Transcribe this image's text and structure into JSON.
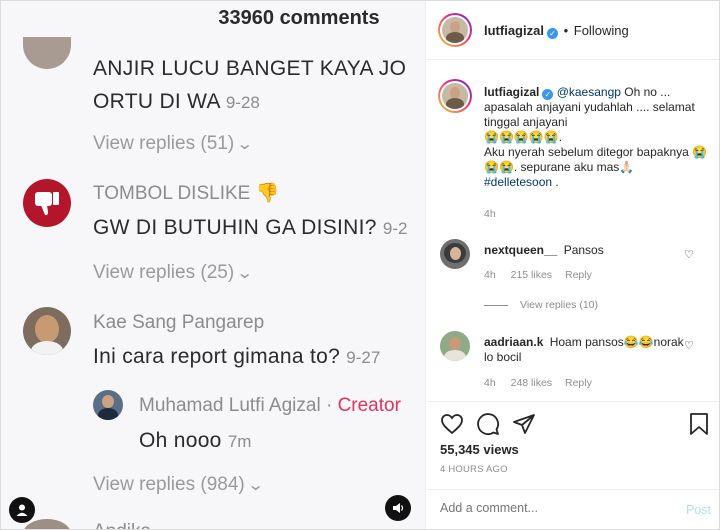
{
  "video": {
    "heading": "33960 comments",
    "comments": [
      {
        "text": "ANJIR LUCU BANGET KAYA JO",
        "text2": "ORTU DI WA",
        "date": "9-28",
        "replies": "View replies (51)"
      },
      {
        "name": "TOMBOL DISLIKE 👎",
        "text": "GW DI BUTUHIN GA DISINI?",
        "date": "9-2",
        "replies": "View replies (25)"
      },
      {
        "name": "Kae Sang Pangarep",
        "text": "Ini cara report gimana to?",
        "date": "9-27"
      },
      {
        "name": "Muhamad Lutfi Agizal",
        "sep": "·",
        "creator": "Creator",
        "text": "Oh nooo",
        "date": "7m",
        "replies": "View replies (984)"
      }
    ],
    "cut_name": "Andika"
  },
  "post": {
    "username": "lutfiagizal",
    "dot": "•",
    "following": "Following",
    "caption": {
      "username": "lutfiagizal",
      "mention": "@kaesangp",
      "line1": " Oh no ... apasalah anjayani yudahlah .... selamat tinggal anjayani",
      "line2": "😭😭😭😭😭.",
      "line3": "Aku nyerah sebelum ditegor bapaknya 😭😭😭. sepurane aku mas🙏🏻",
      "hashtag": "#delletesoon",
      "tail": " .",
      "time": "4h"
    },
    "comments": [
      {
        "user": "nextqueen__",
        "text": "Pansos",
        "time": "4h",
        "likes": "215 likes",
        "reply": "Reply",
        "view_replies": "View replies (10)"
      },
      {
        "user": "aadriaan.k",
        "text": "Hoam pansos😂😂norak lo bocil",
        "time": "4h",
        "likes": "248 likes",
        "reply": "Reply"
      }
    ],
    "views": "55,345 views",
    "posted": "4 HOURS AGO",
    "add_comment_placeholder": "Add a comment...",
    "post_label": "Post"
  },
  "colors": {
    "accent": "#0095f6",
    "creator": "#e5335c",
    "verified": "#3897f0"
  }
}
